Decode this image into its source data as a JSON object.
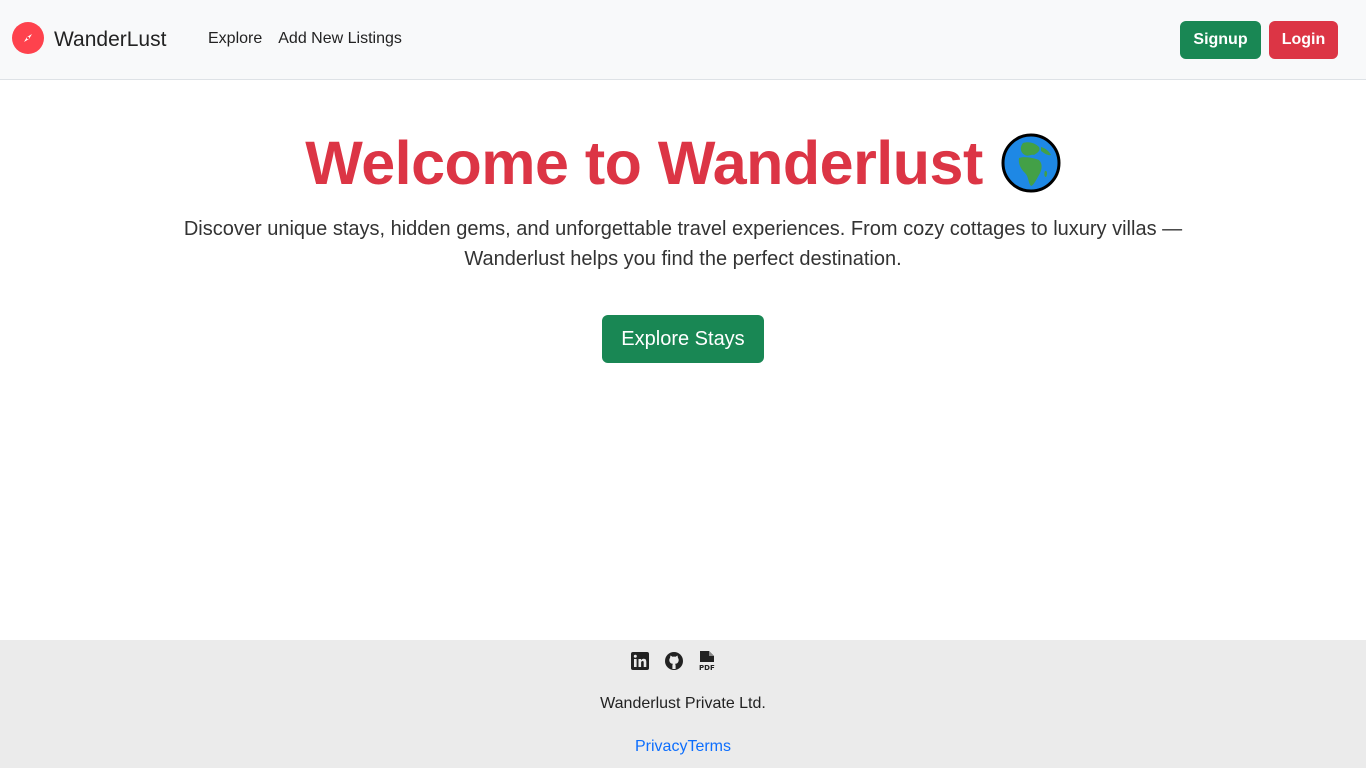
{
  "navbar": {
    "brand": "WanderLust",
    "brand_icon": "compass-icon",
    "links": [
      "Explore",
      "Add New Listings"
    ],
    "signup_label": "Signup",
    "login_label": "Login"
  },
  "hero": {
    "title": "Welcome to Wanderlust",
    "title_icon": "globe-icon",
    "subtitle": "Discover unique stays, hidden gems, and unforgettable travel experiences. From cozy cottages to luxury villas — Wanderlust helps you find the perfect destination.",
    "cta_label": "Explore Stays"
  },
  "footer": {
    "social_icons": [
      "linkedin-icon",
      "github-icon",
      "pdf-icon"
    ],
    "company": "Wanderlust Private Ltd.",
    "privacy_label": "Privacy",
    "terms_label": "Terms"
  },
  "colors": {
    "brand_red": "#fe424d",
    "title_red": "#dc3545",
    "success_green": "#198754",
    "link_blue": "#0d6efd",
    "navbar_bg": "#f8f9fa",
    "footer_bg": "#ebebeb"
  }
}
